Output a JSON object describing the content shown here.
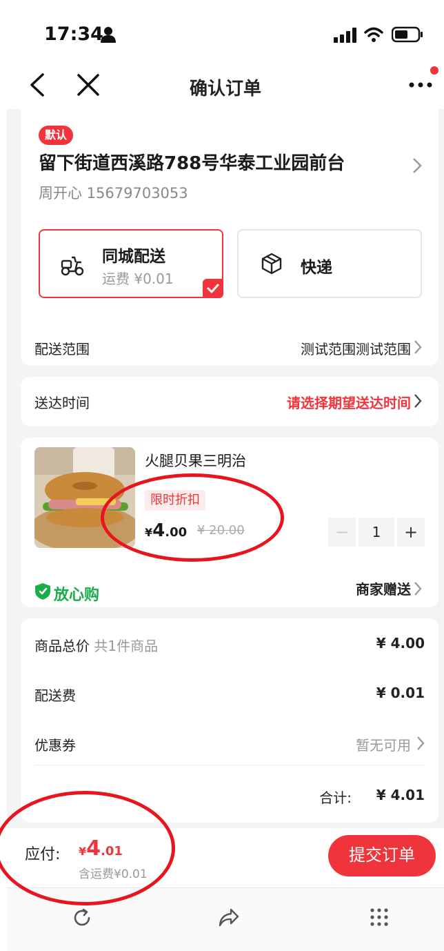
{
  "status_bar": {
    "time": "17:34"
  },
  "nav": {
    "title": "确认订单"
  },
  "address": {
    "badge": "默认",
    "line": "留下街道西溪路788号华泰工业园前台",
    "contact": "周开心 15679703053"
  },
  "delivery_options": [
    {
      "label": "同城配送",
      "fee": "运费 ¥0.01",
      "selected": true
    },
    {
      "label": "快递",
      "selected": false
    }
  ],
  "delivery_range": {
    "label": "配送范围",
    "value": "测试范围测试范围"
  },
  "delivery_time": {
    "label": "送达时间",
    "value": "请选择期望送达时间"
  },
  "product": {
    "name": "火腿贝果三明治",
    "tag": "限时折扣",
    "price_symbol": "¥",
    "price_int": "4",
    "price_dec": ".00",
    "original_price": "¥ 20.00",
    "quantity": "1",
    "minus": "−",
    "plus": "+",
    "assurance": "放心购",
    "gift": "商家赠送"
  },
  "summary": {
    "goods_label": "商品总价",
    "goods_count": "共1件商品",
    "goods_value": "¥ 4.00",
    "shipping_label": "配送费",
    "shipping_value": "¥ 0.01",
    "coupon_label": "优惠券",
    "coupon_value": "暂无可用",
    "total_label": "合计:",
    "total_value": "¥ 4.01"
  },
  "payment": {
    "label": "应付:",
    "symbol": "¥",
    "int": "4",
    "dec": ".01",
    "shipping_note": "含运费¥0.01",
    "submit": "提交订单"
  },
  "colors": {
    "accent": "#f0343b",
    "assurance": "#1aae4a",
    "annotation": "#e8141e"
  },
  "icons": [
    "person-icon",
    "signal-icon",
    "wifi-icon",
    "battery-icon",
    "back-icon",
    "close-icon",
    "more-icon",
    "scooter-icon",
    "box-icon",
    "check-icon",
    "chevron-right-icon",
    "shield-icon",
    "refresh-icon",
    "share-icon",
    "grid-icon"
  ]
}
